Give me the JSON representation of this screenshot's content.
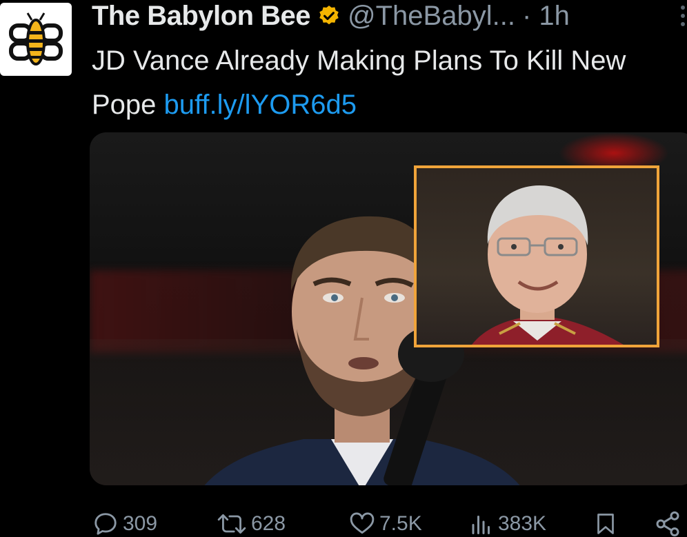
{
  "author": {
    "name": "The Babylon Bee",
    "handle": "@TheBabyl...",
    "time": "· 1h",
    "avatar_icon": "bee-logo-icon",
    "verified_icon": "verified-badge-icon",
    "verified_color": "#f4b400"
  },
  "tweet": {
    "text": "JD Vance Already Making Plans To Kill New Pope",
    "link": "buff.ly/lYOR6d5",
    "link_color": "#1d9bf0"
  },
  "media": {
    "main_photo": "photo-of-speaker-at-microphone",
    "inset_photo": "photo-of-clergyman",
    "inset_border_color": "#f0a43a"
  },
  "actions": {
    "replies": "309",
    "reposts": "628",
    "likes": "7.5K",
    "views": "383K",
    "reply_icon": "reply-icon",
    "repost_icon": "repost-icon",
    "like_icon": "heart-icon",
    "views_icon": "views-icon",
    "bookmark_icon": "bookmark-icon",
    "share_icon": "share-icon"
  }
}
